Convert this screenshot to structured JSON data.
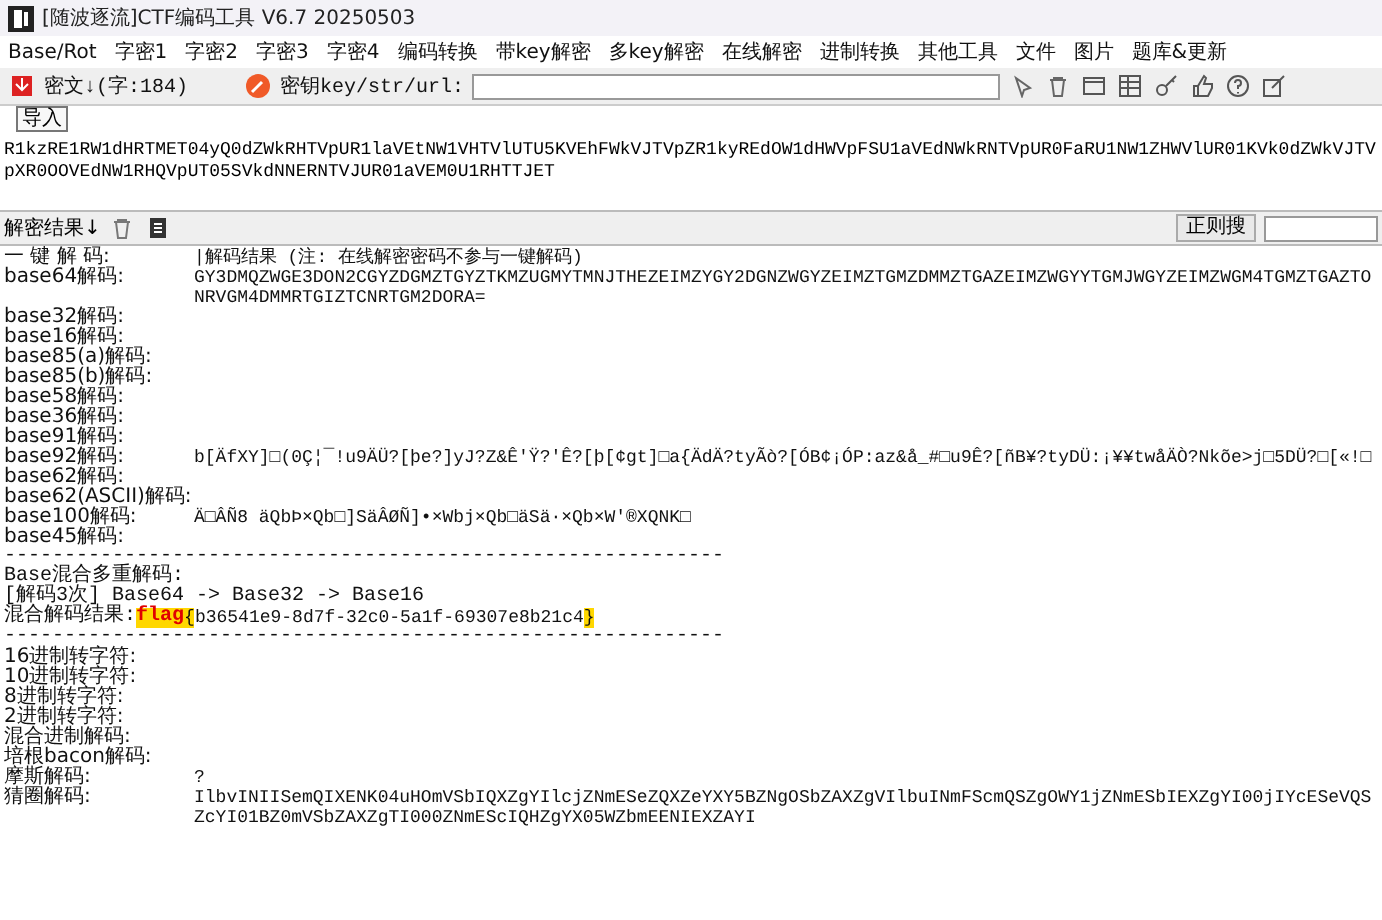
{
  "window": {
    "title": "[随波逐流]CTF编码工具 V6.7  20250503"
  },
  "menu": [
    "Base/Rot",
    "字密1",
    "字密2",
    "字密3",
    "字密4",
    "编码转换",
    "带key解密",
    "多key解密",
    "在线解密",
    "进制转换",
    "其他工具",
    "文件",
    "图片",
    "题库&更新"
  ],
  "toolbar": {
    "cipher_label": "密文↓(字:184)",
    "tooltip": "导入",
    "key_label": "密钥key/str/url:"
  },
  "input_text": "R1kzRE1RW1dHRTMET04yQ0dZWkRHTVpUR1laVEtNW1VHTVlUTU5KVEhFWkVJTVpZR1kyREdOW1dHWVpFSU1aVEdNWkRNTVpUR0FaRU1NW1ZHWVlUR01KVk0dZWkVJTVpXR0OOVEdNW1RHQVpUT05SVkdNNERNTVJUR01aVEM0U1RHTTJET",
  "results_bar": {
    "label": "解密结果↓",
    "search_button": "正则搜"
  },
  "results": [
    {
      "kind": "row",
      "label": "一 键 解 码:",
      "value": "|解码结果 (注: 在线解密密码不参与一键解码)"
    },
    {
      "kind": "row",
      "label": "base64解码:",
      "value": "GY3DMQZWGE3DON2CGYZDGMZTGYZTKMZUGMYTMNJTHEZEIMZYGY2DGNZWGYZEIMZTGMZDMMZTGAZEIMZWGYYTGMJWGYZEIMZWGM4TGMZTGAZTONRVGM4DMMRTGIZTCNRTGM2DORA="
    },
    {
      "kind": "row",
      "label": "base32解码:"
    },
    {
      "kind": "row",
      "label": "base16解码:"
    },
    {
      "kind": "row",
      "label": "base85(a)解码:"
    },
    {
      "kind": "row",
      "label": "base85(b)解码:"
    },
    {
      "kind": "row",
      "label": "base58解码:"
    },
    {
      "kind": "row",
      "label": "base36解码:"
    },
    {
      "kind": "row",
      "label": "base91解码:"
    },
    {
      "kind": "row",
      "label": "base92解码:",
      "value": "b[ÄfXY]□(0Ç¦¯!u9ÄÜ?[þe?]yJ?Z&Ê'Ÿ?'Ê?[þ[¢gt]□a{ÄdÄ?tyÃò?[ÓB¢¡ÓP:az&å_#□u9Ê?[ñB¥?tyDÜ:¡¥¥twåÄÒ?Nkõe>j□5DÜ?□[«!□"
    },
    {
      "kind": "row",
      "label": "base62解码:"
    },
    {
      "kind": "row",
      "label": "base62(ASCII)解码:"
    },
    {
      "kind": "row",
      "label": "base100解码:",
      "value": "Ä□ÂÑ8 äQbÞ×Qb□]SäÂØÑ]•×Wbj×Qb□äSä·×Qb×W'®XQNK□"
    },
    {
      "kind": "row",
      "label": "base45解码:"
    },
    {
      "kind": "line",
      "text": "------------------------------------------------------------"
    },
    {
      "kind": "line",
      "text": "Base混合多重解码:"
    },
    {
      "kind": "line",
      "text": "[解码3次] Base64 -> Base32 -> Base16"
    },
    {
      "kind": "flag",
      "label": "混合解码结果:",
      "segments": [
        {
          "kind": "keyword",
          "text": "flag"
        },
        {
          "kind": "brace",
          "text": "{"
        },
        {
          "kind": "plain",
          "text": "b36541e9-8d7f-32c0-5a1f-69307e8b21c4"
        },
        {
          "kind": "brace",
          "text": "}"
        }
      ]
    },
    {
      "kind": "line",
      "text": "------------------------------------------------------------"
    },
    {
      "kind": "row",
      "label": "16进制转字符:"
    },
    {
      "kind": "row",
      "label": "10进制转字符:"
    },
    {
      "kind": "row",
      "label": "8进制转字符:"
    },
    {
      "kind": "row",
      "label": "2进制转字符:"
    },
    {
      "kind": "row",
      "label": "混合进制解码:"
    },
    {
      "kind": "row",
      "label": "培根bacon解码:"
    },
    {
      "kind": "row",
      "label": "摩斯解码:",
      "value": "?"
    },
    {
      "kind": "row",
      "label": "猜圈解码:",
      "value": "IlbvINIISemQIXENK04uHOmVSbIQXZgYIlcjZNmESeZQXZeYXY5BZNgOSbZAXZgVIlbuINmFScmQSZgOWY1jZNmESbIEXZgYI00jIYcESeVQSZcYI01BZ0mVSbZAXZgTI000ZNmEScIQHZgYX05WZbmEENIEXZAYI"
    }
  ]
}
